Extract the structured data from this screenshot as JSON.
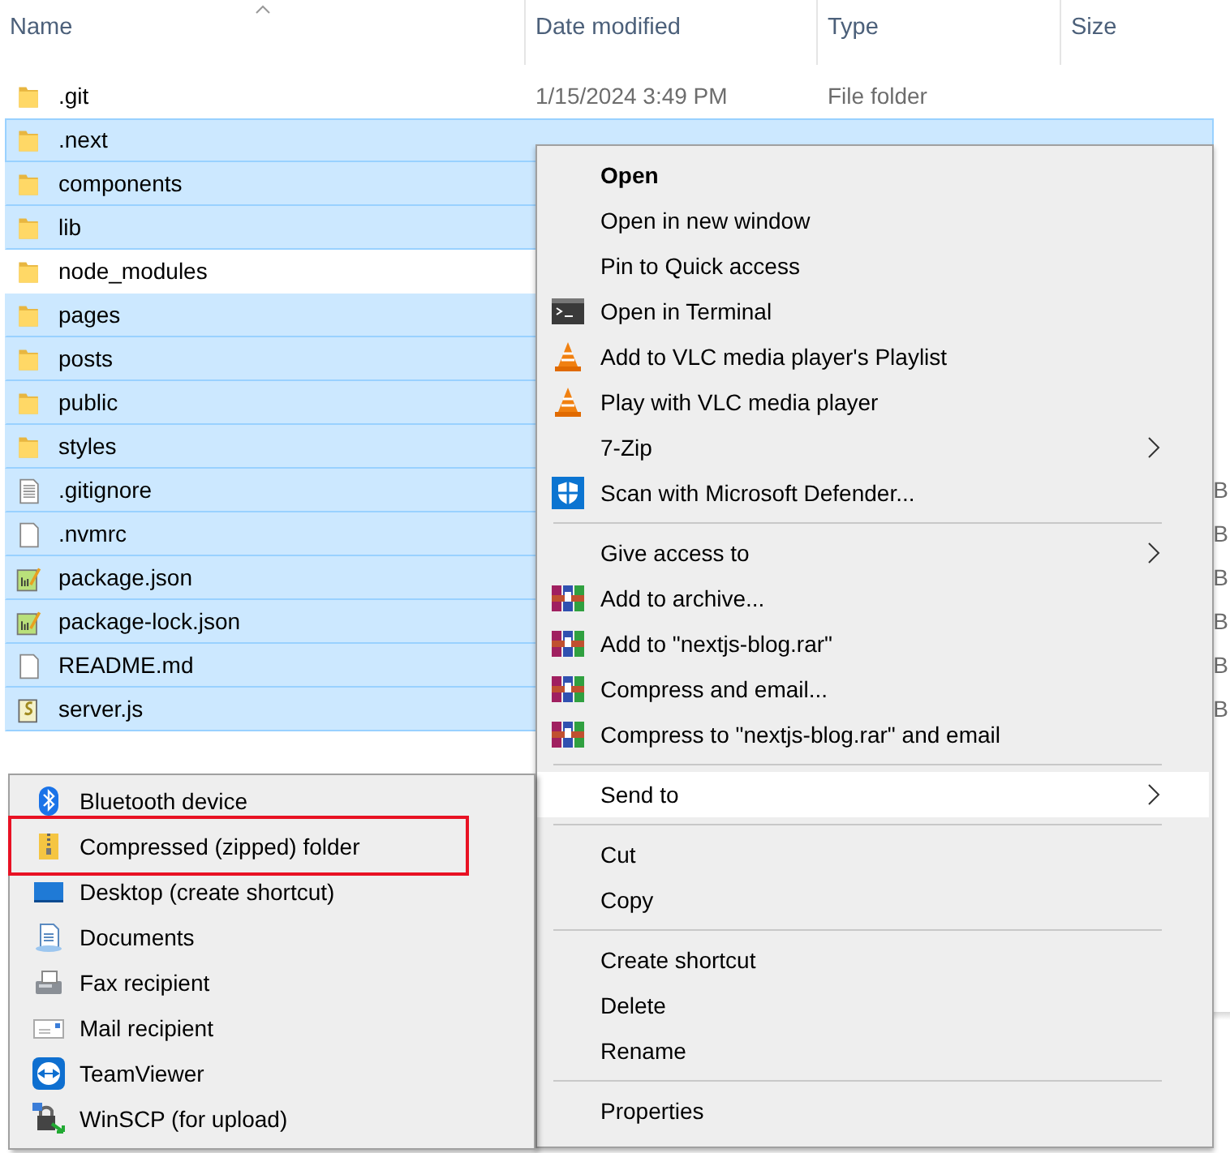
{
  "columns": [
    {
      "label": "Name",
      "sorted": true
    },
    {
      "label": "Date modified",
      "sorted": false
    },
    {
      "label": "Type",
      "sorted": false
    },
    {
      "label": "Size",
      "sorted": false
    }
  ],
  "files": [
    {
      "name": ".git",
      "kind": "folder",
      "selected": false,
      "focused": false,
      "date": "1/15/2024 3:49 PM",
      "type": "File folder"
    },
    {
      "name": ".next",
      "kind": "folder",
      "selected": true,
      "focused": true
    },
    {
      "name": "components",
      "kind": "folder",
      "selected": true,
      "focused": false
    },
    {
      "name": "lib",
      "kind": "folder",
      "selected": true,
      "focused": false
    },
    {
      "name": "node_modules",
      "kind": "folder",
      "selected": false,
      "focused": false
    },
    {
      "name": "pages",
      "kind": "folder",
      "selected": true,
      "focused": false
    },
    {
      "name": "posts",
      "kind": "folder",
      "selected": true,
      "focused": false
    },
    {
      "name": "public",
      "kind": "folder",
      "selected": true,
      "focused": false
    },
    {
      "name": "styles",
      "kind": "folder",
      "selected": true,
      "focused": false
    },
    {
      "name": ".gitignore",
      "kind": "text",
      "selected": true,
      "focused": false,
      "size": "B"
    },
    {
      "name": ".nvmrc",
      "kind": "blank",
      "selected": true,
      "focused": false,
      "size": "B"
    },
    {
      "name": "package.json",
      "kind": "json",
      "selected": true,
      "focused": false,
      "size": "B"
    },
    {
      "name": "package-lock.json",
      "kind": "json",
      "selected": true,
      "focused": false,
      "size": "B"
    },
    {
      "name": "README.md",
      "kind": "blank",
      "selected": true,
      "focused": false,
      "size": "B"
    },
    {
      "name": "server.js",
      "kind": "script",
      "selected": true,
      "focused": false,
      "size": "B"
    }
  ],
  "context_menu": {
    "groups": [
      [
        {
          "label": "Open",
          "kind": "plain",
          "bold": true,
          "submenu": false,
          "selected": false
        },
        {
          "label": "Open in new window",
          "kind": "plain",
          "bold": false,
          "submenu": false,
          "selected": false
        },
        {
          "label": "Pin to Quick access",
          "kind": "plain",
          "bold": false,
          "submenu": false,
          "selected": false
        },
        {
          "label": "Open in Terminal",
          "kind": "terminal",
          "bold": false,
          "submenu": false,
          "selected": false
        },
        {
          "label": "Add to VLC media player's Playlist",
          "kind": "vlc",
          "bold": false,
          "submenu": false,
          "selected": false
        },
        {
          "label": "Play with VLC media player",
          "kind": "vlc",
          "bold": false,
          "submenu": false,
          "selected": false
        },
        {
          "label": "7-Zip",
          "kind": "plain",
          "bold": false,
          "submenu": true,
          "selected": false
        },
        {
          "label": "Scan with Microsoft Defender...",
          "kind": "shield",
          "bold": false,
          "submenu": false,
          "selected": false
        }
      ],
      [
        {
          "label": "Give access to",
          "kind": "plain",
          "bold": false,
          "submenu": true,
          "selected": false
        },
        {
          "label": "Add to archive...",
          "kind": "rar",
          "bold": false,
          "submenu": false,
          "selected": false
        },
        {
          "label": "Add to \"nextjs-blog.rar\"",
          "kind": "rar",
          "bold": false,
          "submenu": false,
          "selected": false
        },
        {
          "label": "Compress and email...",
          "kind": "rar",
          "bold": false,
          "submenu": false,
          "selected": false
        },
        {
          "label": "Compress to \"nextjs-blog.rar\" and email",
          "kind": "rar",
          "bold": false,
          "submenu": false,
          "selected": false
        }
      ],
      [
        {
          "label": "Send to",
          "kind": "plain",
          "bold": false,
          "submenu": true,
          "selected": true
        }
      ],
      [
        {
          "label": "Cut",
          "kind": "plain",
          "bold": false,
          "submenu": false,
          "selected": false
        },
        {
          "label": "Copy",
          "kind": "plain",
          "bold": false,
          "submenu": false,
          "selected": false
        }
      ],
      [
        {
          "label": "Create shortcut",
          "kind": "plain",
          "bold": false,
          "submenu": false,
          "selected": false
        },
        {
          "label": "Delete",
          "kind": "plain",
          "bold": false,
          "submenu": false,
          "selected": false
        },
        {
          "label": "Rename",
          "kind": "plain",
          "bold": false,
          "submenu": false,
          "selected": false
        }
      ],
      [
        {
          "label": "Properties",
          "kind": "plain",
          "bold": false,
          "submenu": false,
          "selected": false
        }
      ]
    ]
  },
  "send_to_menu": {
    "items": [
      {
        "label": "Bluetooth device",
        "kind": "bluetooth",
        "annotated": false
      },
      {
        "label": "Compressed (zipped) folder",
        "kind": "zip",
        "annotated": true
      },
      {
        "label": "Desktop (create shortcut)",
        "kind": "desktop",
        "annotated": false
      },
      {
        "label": "Documents",
        "kind": "documents",
        "annotated": false
      },
      {
        "label": "Fax recipient",
        "kind": "fax",
        "annotated": false
      },
      {
        "label": "Mail recipient",
        "kind": "mail",
        "annotated": false
      },
      {
        "label": "TeamViewer",
        "kind": "teamviewer",
        "annotated": false
      },
      {
        "label": "WinSCP (for upload)",
        "kind": "winscp",
        "annotated": false
      }
    ]
  }
}
